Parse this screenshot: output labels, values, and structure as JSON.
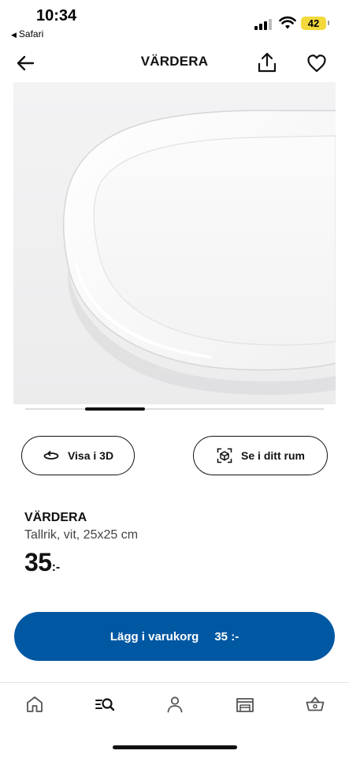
{
  "status_bar": {
    "time": "10:34",
    "back_app": "Safari",
    "battery": "42"
  },
  "nav": {
    "title": "VÄRDERA"
  },
  "image": {
    "alt": "White square plate, close-up of corner"
  },
  "gallery": {
    "active_index": 1,
    "count": 5
  },
  "actions": {
    "view_3d": "Visa i 3D",
    "view_in_room": "Se i ditt rum"
  },
  "product": {
    "name": "VÄRDERA",
    "description": "Tallrik, vit, 25x25 cm",
    "price_integer": "35",
    "price_suffix": ":-"
  },
  "cart_button": {
    "label": "Lägg i varukorg",
    "price": "35 :-"
  },
  "tab_bar": {
    "items": [
      {
        "icon": "home-icon"
      },
      {
        "icon": "search-icon",
        "active": true
      },
      {
        "icon": "profile-icon"
      },
      {
        "icon": "store-icon"
      },
      {
        "icon": "basket-icon"
      }
    ]
  },
  "colors": {
    "accent": "#0058a3",
    "battery": "#f3d93b",
    "text": "#111111"
  }
}
